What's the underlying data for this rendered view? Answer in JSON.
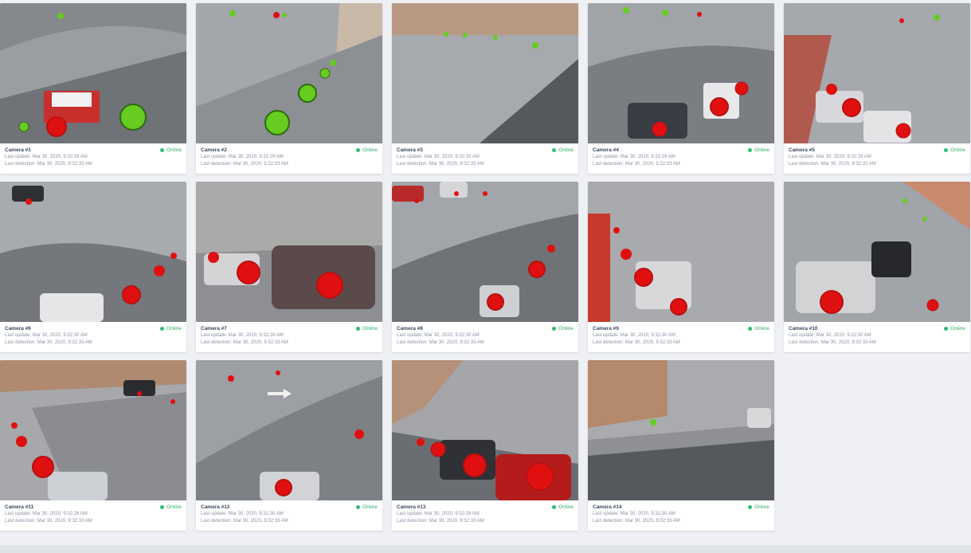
{
  "status_label": "Online",
  "cameras": [
    {
      "name": "Camera #1",
      "last_update": "Last update: Mar 30, 2020, 9:32:29 AM",
      "last_detection": "Last detection: Mar 30, 2020, 9:32:33 AM"
    },
    {
      "name": "Camera #2",
      "last_update": "Last update: Mar 30, 2020, 9:32:29 AM",
      "last_detection": "Last detection: Mar 30, 2020, 9:32:33 AM"
    },
    {
      "name": "Camera #3",
      "last_update": "Last update: Mar 30, 2020, 9:32:30 AM",
      "last_detection": "Last detection: Mar 30, 2020, 9:32:33 AM"
    },
    {
      "name": "Camera #4",
      "last_update": "Last update: Mar 30, 2020, 9:32:29 AM",
      "last_detection": "Last detection: Mar 30, 2020, 9:32:33 AM"
    },
    {
      "name": "Camera #5",
      "last_update": "Last update: Mar 30, 2020, 9:32:29 AM",
      "last_detection": "Last detection: Mar 30, 2020, 9:32:33 AM"
    },
    {
      "name": "Camera #6",
      "last_update": "Last update: Mar 30, 2020, 9:32:30 AM",
      "last_detection": "Last detection: Mar 30, 2020, 9:32:33 AM"
    },
    {
      "name": "Camera #7",
      "last_update": "Last update: Mar 30, 2020, 9:32:28 AM",
      "last_detection": "Last detection: Mar 30, 2020, 9:32:33 AM"
    },
    {
      "name": "Camera #8",
      "last_update": "Last update: Mar 30, 2020, 9:32:30 AM",
      "last_detection": "Last detection: Mar 30, 2020, 9:32:33 AM"
    },
    {
      "name": "Camera #9",
      "last_update": "Last update: Mar 30, 2020, 9:32:30 AM",
      "last_detection": "Last detection: Mar 30, 2020, 9:32:33 AM"
    },
    {
      "name": "Camera #10",
      "last_update": "Last update: Mar 30, 2020, 9:32:30 AM",
      "last_detection": "Last detection: Mar 30, 2020, 9:32:33 AM"
    },
    {
      "name": "Camera #11",
      "last_update": "Last update: Mar 30, 2020, 9:32:28 AM",
      "last_detection": "Last detection: Mar 30, 2020, 9:32:33 AM"
    },
    {
      "name": "Camera #12",
      "last_update": "Last update: Mar 30, 2020, 9:32:30 AM",
      "last_detection": "Last detection: Mar 30, 2020, 9:32:33 AM"
    },
    {
      "name": "Camera #13",
      "last_update": "Last update: Mar 30, 2020, 9:32:29 AM",
      "last_detection": "Last detection: Mar 30, 2020, 9:32:33 AM"
    },
    {
      "name": "Camera #14",
      "last_update": "Last update: Mar 30, 2020, 9:32:30 AM",
      "last_detection": "Last detection: Mar 30, 2020, 9:32:33 AM"
    }
  ],
  "colors": {
    "occupied_marker": "#e01010",
    "free_marker": "#66cc22",
    "online": "#2fbf71"
  },
  "icons": {
    "status": "status-dot-icon",
    "occupied": "occupied-spot-marker",
    "free": "free-spot-marker"
  }
}
